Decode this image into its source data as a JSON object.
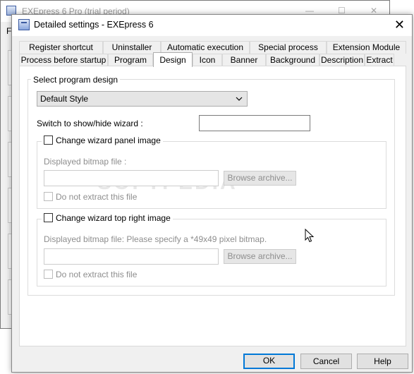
{
  "bg_window": {
    "title": "EXEpress 6 Pro (trial period)",
    "menu_stub": "F",
    "minimize": "—",
    "maximize": "☐",
    "close": "✕"
  },
  "dialog": {
    "title": "Detailed settings - EXEpress 6",
    "close": "✕"
  },
  "tabs_row1": [
    {
      "label": "Register shortcut"
    },
    {
      "label": "Uninstaller"
    },
    {
      "label": "Automatic execution"
    },
    {
      "label": "Special process"
    },
    {
      "label": "Extension Module"
    }
  ],
  "tabs_row2": [
    {
      "label": "Process before startup"
    },
    {
      "label": "Program"
    },
    {
      "label": "Design",
      "selected": true
    },
    {
      "label": "Icon"
    },
    {
      "label": "Banner"
    },
    {
      "label": "Background"
    },
    {
      "label": "Description"
    },
    {
      "label": "Extract"
    }
  ],
  "design": {
    "group_label": "Select program design",
    "design_value": "Default Style",
    "wizard_toggle_label": "Switch to show/hide wizard :",
    "wizard_toggle_value": "",
    "panel_image": {
      "checkbox_label": "Change wizard panel image",
      "field_label": "Displayed bitmap file :",
      "field_value": "",
      "browse": "Browse archive...",
      "no_extract": "Do not extract this file"
    },
    "top_right_image": {
      "checkbox_label": "Change wizard top right image",
      "field_label": "Displayed bitmap file: Please specify a *49x49 pixel bitmap.",
      "field_value": "",
      "browse": "Browse archive...",
      "no_extract": "Do not extract this file"
    }
  },
  "buttons": {
    "ok": "OK",
    "cancel": "Cancel",
    "help": "Help"
  },
  "watermark": "SOFTPEDIA"
}
